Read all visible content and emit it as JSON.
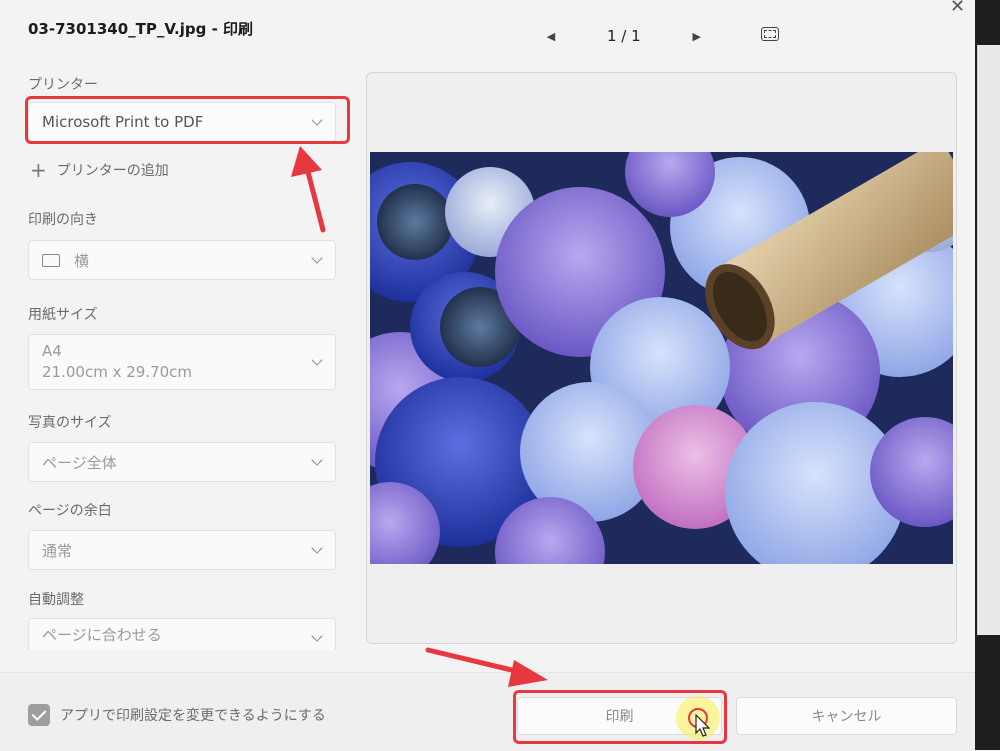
{
  "window": {
    "title": "03-7301340_TP_V.jpg - 印刷",
    "close_label": "✕"
  },
  "pager": {
    "text": "1 / 1",
    "prev_icon": "triangle-left-icon",
    "next_icon": "triangle-right-icon",
    "fit_icon": "fit-to-window-icon"
  },
  "printer": {
    "label": "プリンター",
    "value": "Microsoft Print to PDF",
    "add_label": "プリンターの追加"
  },
  "orientation": {
    "label": "印刷の向き",
    "value": "横"
  },
  "paper": {
    "label": "用紙サイズ",
    "value_line1": "A4",
    "value_line2": "21.00cm x 29.70cm"
  },
  "photo_size": {
    "label": "写真のサイズ",
    "value": "ページ全体"
  },
  "margins": {
    "label": "ページの余白",
    "value": "通常"
  },
  "auto_adjust": {
    "label": "自動調整",
    "value": "ページに合わせる"
  },
  "footer": {
    "checkbox_label": "アプリで印刷設定を変更できるようにする",
    "checkbox_checked": true,
    "print_button": "印刷",
    "cancel_button": "キャンセル"
  },
  "colors": {
    "annotation_red": "#e8383f",
    "cursor_highlight": "#faf050"
  }
}
